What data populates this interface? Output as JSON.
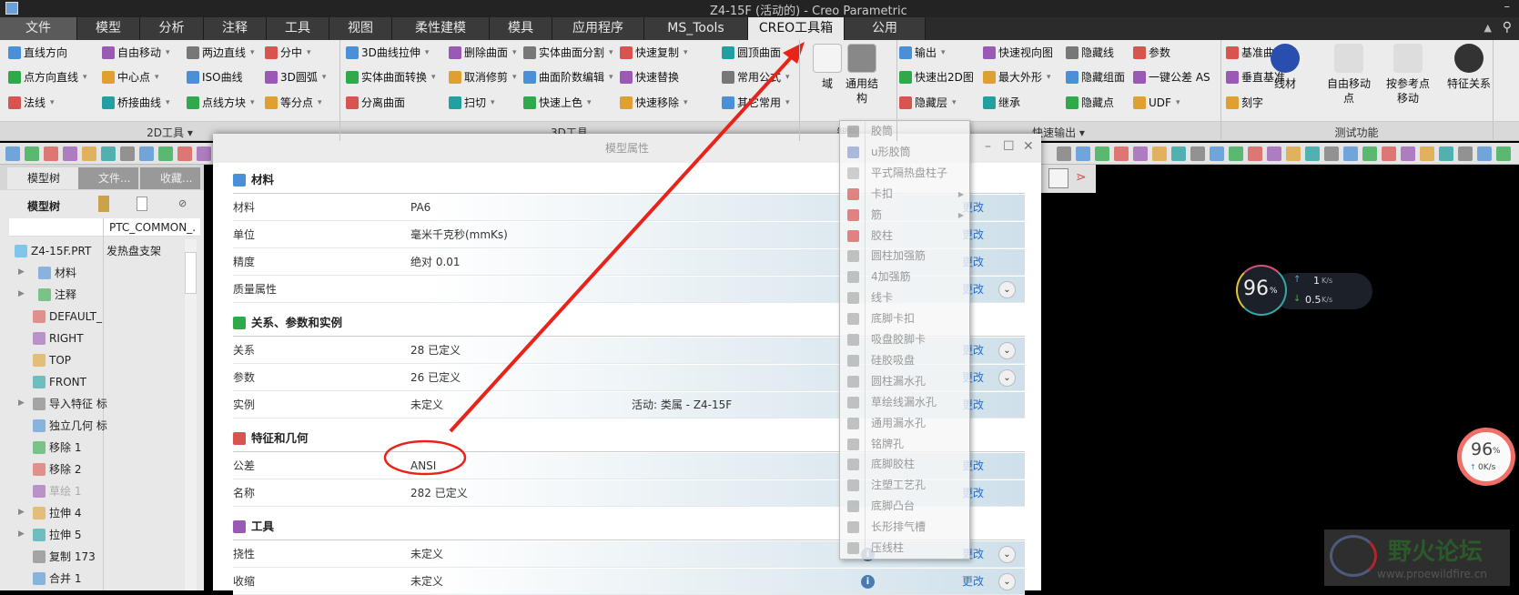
{
  "window": {
    "title": "Z4-15F (活动的) - Creo Parametric"
  },
  "tabs": [
    "文件",
    "模型",
    "分析",
    "注释",
    "工具",
    "视图",
    "柔性建模",
    "模具",
    "应用程序",
    "MS_Tools",
    "CREO工具箱",
    "公用"
  ],
  "active_tab": "CREO工具箱",
  "ribbon": {
    "groups": [
      "2D工具 ▾",
      "3D工具",
      "智能",
      "快速输出 ▾",
      "测试功能"
    ],
    "items_2d": [
      [
        "直线方向",
        "点方向直线",
        "法线"
      ],
      [
        "自由移动",
        "中心点",
        "桥接曲线"
      ],
      [
        "两边直线",
        "ISO曲线",
        "点线方块"
      ],
      [
        "分中",
        "3D圆弧",
        "等分点"
      ]
    ],
    "items_3d": [
      [
        "3D曲线拉伸",
        "实体曲面转换",
        "分离曲面"
      ],
      [
        "删除曲面",
        "取消修剪",
        "扫切"
      ],
      [
        "实体曲面分割",
        "曲面阶数编辑",
        "快速上色"
      ],
      [
        "快速复制",
        "快速替换",
        "快速移除"
      ],
      [
        "圆顶曲面",
        "常用公式",
        "其它常用"
      ]
    ],
    "smart": [
      "域",
      "通用结构"
    ],
    "items_output": [
      [
        "输出",
        "快速出2D图",
        "隐藏层"
      ],
      [
        "快速视向图",
        "最大外形",
        "继承"
      ],
      [
        "隐藏线",
        "隐藏组面",
        "隐藏点"
      ],
      [
        "参数",
        "一键公差 AS",
        "UDF"
      ]
    ],
    "items_test": [
      "基准曲面",
      "垂直基准",
      "刻字"
    ],
    "test_big": [
      "线材",
      "自由移动\n点",
      "按参考点\n移动",
      "特征关系"
    ],
    "dropdown_marker": "▾"
  },
  "left_panel": {
    "tabs": [
      "模型树",
      "文件...",
      "收藏..."
    ],
    "header": "模型树",
    "column_header": "PTC_COMMON_.",
    "root": {
      "name": "Z4-15F.PRT",
      "common_name": "发热盘支架"
    },
    "items": [
      "材料",
      "注释",
      "DEFAULT_",
      "RIGHT",
      "TOP",
      "FRONT",
      "导入特征 标",
      "独立几何 标",
      "移除 1",
      "移除 2",
      "草绘 1",
      "拉伸 4",
      "拉伸 5",
      "复制 173",
      "合并 1"
    ]
  },
  "dialog": {
    "title": "模型属性",
    "change_label": "更改",
    "sections": [
      {
        "title": "材料",
        "rows": [
          {
            "label": "材料",
            "value": "PA6",
            "change": true
          },
          {
            "label": "单位",
            "value": "毫米千克秒(mmKs)",
            "change": true
          },
          {
            "label": "精度",
            "value": "绝对 0.01",
            "change": true
          },
          {
            "label": "质量属性",
            "value": "",
            "change": true,
            "expand": true
          }
        ]
      },
      {
        "title": "关系、参数和实例",
        "rows": [
          {
            "label": "关系",
            "value": "28 已定义",
            "change": true,
            "expand": true
          },
          {
            "label": "参数",
            "value": "26 已定义",
            "change": true,
            "expand": true
          },
          {
            "label": "实例",
            "value": "未定义",
            "extra": "活动: 类属 - Z4-15F",
            "change": true
          }
        ]
      },
      {
        "title": "特征和几何",
        "rows": [
          {
            "label": "公差",
            "value": "ANSI",
            "change": true
          },
          {
            "label": "名称",
            "value": "282 已定义",
            "change": true
          }
        ]
      },
      {
        "title": "工具",
        "rows": [
          {
            "label": "挠性",
            "value": "未定义",
            "change": true,
            "expand": true,
            "info": true
          },
          {
            "label": "收缩",
            "value": "未定义",
            "change": true,
            "expand": true,
            "info": true
          }
        ]
      }
    ]
  },
  "dropdown_menu": {
    "items": [
      {
        "label": "胶筒"
      },
      {
        "label": "u形胶筒"
      },
      {
        "label": "平式隔热盘柱子"
      },
      {
        "label": "卡扣",
        "submenu": true
      },
      {
        "label": "筋",
        "submenu": true
      },
      {
        "label": "胶柱"
      },
      {
        "label": "圆柱加强筋"
      },
      {
        "label": "4加强筋"
      },
      {
        "label": "线卡"
      },
      {
        "label": "底脚卡扣"
      },
      {
        "label": "吸盘胶脚卡"
      },
      {
        "label": "硅胶吸盘"
      },
      {
        "label": "圆柱漏水孔"
      },
      {
        "label": "草绘线漏水孔"
      },
      {
        "label": "通用漏水孔"
      },
      {
        "label": "铭牌孔"
      },
      {
        "label": "底脚胶柱"
      },
      {
        "label": "注塑工艺孔"
      },
      {
        "label": "底脚凸台"
      },
      {
        "label": "长形排气槽"
      },
      {
        "label": "压线柱"
      }
    ]
  },
  "widgets": {
    "net_monitor": {
      "percent": "96",
      "unit": "%",
      "up": "1",
      "down": "0.5",
      "rate_unit": "K/s"
    },
    "mini_monitor": {
      "percent": "96",
      "unit": "%",
      "up": "0K/s"
    }
  },
  "watermark": {
    "name": "野火论坛",
    "url": "www.proewildfire.cn"
  },
  "colors": {
    "annotation": "#e8231a",
    "link": "#2b6fc6",
    "active_tab": "#e9e9e9"
  }
}
